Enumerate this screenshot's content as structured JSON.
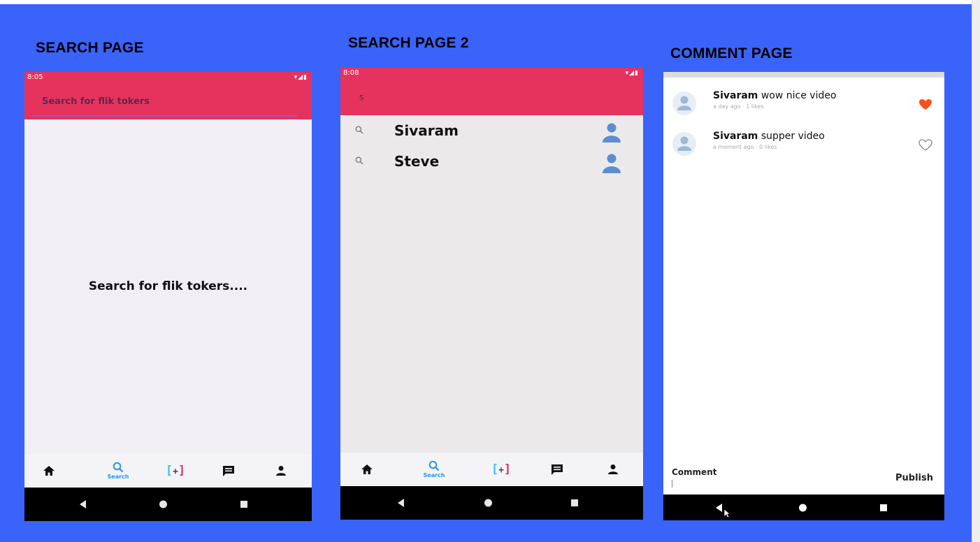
{
  "captions": {
    "search_page": "SEARCH PAGE",
    "search_page_2": "SEARCH PAGE 2",
    "comment_page": "COMMENT PAGE"
  },
  "phone1": {
    "status_time": "8:05",
    "search_placeholder": "Search for flik tokers",
    "empty_message": "Search for flik tokers....",
    "nav_search_label": "Search",
    "appbar_color": "#e6335e"
  },
  "phone2": {
    "status_time": "8:08",
    "search_value": "s",
    "nav_search_label": "Search",
    "results": [
      {
        "name": "Sivaram"
      },
      {
        "name": "Steve"
      }
    ]
  },
  "phone3": {
    "comments": [
      {
        "user": "Sivaram",
        "text": "wow nice video",
        "time": "a day ago",
        "likes": "1 likes",
        "liked": true
      },
      {
        "user": "Sivaram",
        "text": "supper video",
        "time": "a moment ago",
        "likes": "0 likes",
        "liked": false
      }
    ],
    "comment_label": "Comment",
    "publish_label": "Publish"
  },
  "colors": {
    "slide_background": "#3a63f9",
    "appbar": "#e6335e",
    "heart_liked": "#f4511e",
    "nav_active": "#2196f3",
    "avatar": "#5a8ed0"
  },
  "icons": {
    "home": "home-icon",
    "search": "search-icon",
    "add": "add-video-icon",
    "inbox": "message-icon",
    "profile": "person-icon",
    "heart": "heart-icon"
  }
}
